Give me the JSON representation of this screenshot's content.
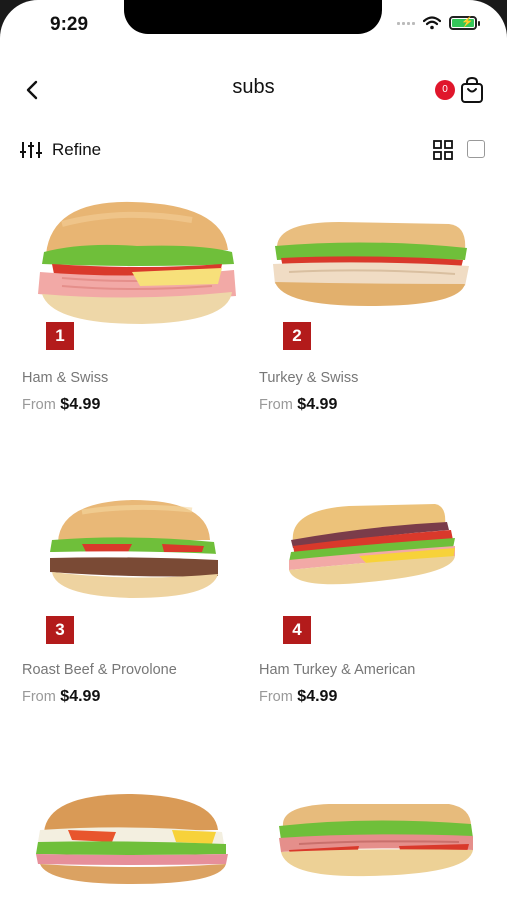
{
  "status": {
    "time": "9:29"
  },
  "header": {
    "title": "subs",
    "cart_count": "0"
  },
  "refine": {
    "label": "Refine"
  },
  "products": [
    {
      "number": "1",
      "name": "Ham & Swiss",
      "from": "From",
      "price": "$4.99"
    },
    {
      "number": "2",
      "name": "Turkey & Swiss",
      "from": "From",
      "price": "$4.99"
    },
    {
      "number": "3",
      "name": "Roast Beef & Provolone",
      "from": "From",
      "price": "$4.99"
    },
    {
      "number": "4",
      "name": "Ham Turkey & American",
      "from": "From",
      "price": "$4.99"
    }
  ],
  "colors": {
    "badge": "#e0162b",
    "number_tag": "#b31b1b",
    "bread": "#e9b877",
    "lettuce": "#6fbf3a",
    "tomato": "#d9392b",
    "ham": "#f2a9a6",
    "cheese": "#f7e07a",
    "beef": "#7a4a35"
  }
}
